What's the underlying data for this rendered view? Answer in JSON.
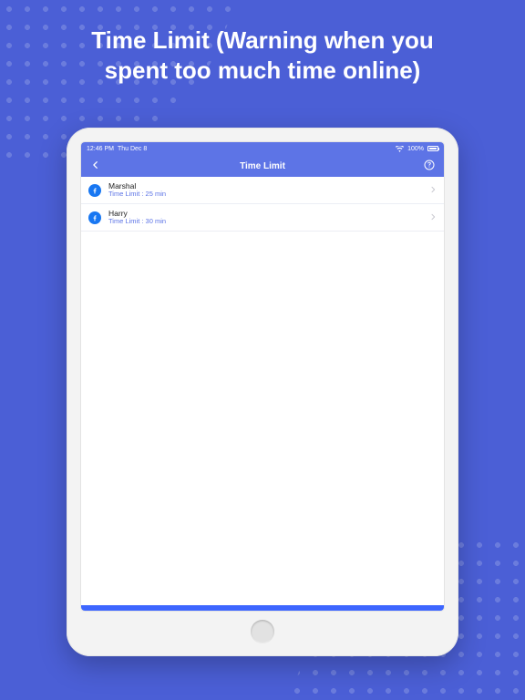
{
  "promo": {
    "headline_line1": "Time Limit (Warning when you",
    "headline_line2": "spent too much time online)"
  },
  "status": {
    "time": "12:46 PM",
    "date": "Thu Dec 8",
    "wifi_label": "wifi",
    "battery_pct": "100%"
  },
  "nav": {
    "title": "Time Limit"
  },
  "list": {
    "items": [
      {
        "name": "Marshal",
        "subtitle": "Time Limit : 25 min"
      },
      {
        "name": "Harry",
        "subtitle": "Time Limit : 30 min"
      }
    ]
  }
}
